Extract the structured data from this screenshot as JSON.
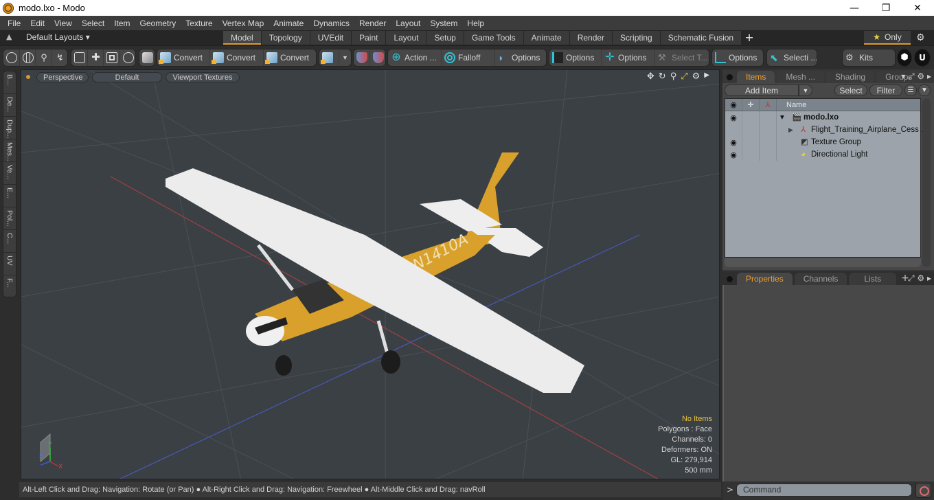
{
  "window": {
    "title": "modo.lxo - Modo",
    "controls": {
      "minimize": "—",
      "maximize": "❐",
      "close": "✕"
    }
  },
  "menu": [
    "File",
    "Edit",
    "View",
    "Select",
    "Item",
    "Geometry",
    "Texture",
    "Vertex Map",
    "Animate",
    "Dynamics",
    "Render",
    "Layout",
    "System",
    "Help"
  ],
  "layout_bar": {
    "default_layouts": "Default Layouts ▾",
    "tabs": [
      "Model",
      "Topology",
      "UVEdit",
      "Paint",
      "Layout",
      "Setup",
      "Game Tools",
      "Animate",
      "Render",
      "Scripting",
      "Schematic Fusion"
    ],
    "active_tab": "Model",
    "add_tab": "+",
    "only_label": "Only",
    "star_icon": "★",
    "gear_icon": "⚙"
  },
  "toolbar": {
    "convert_1": "Convert",
    "convert_2": "Convert",
    "convert_3": "Convert",
    "action": "Action ...",
    "falloff": "Falloff",
    "options_1": "Options",
    "options_2": "Options",
    "options_3": "Options",
    "select_t": "Select T...",
    "options_4": "Options",
    "selecti": "Selecti ...",
    "kits": "Kits"
  },
  "left_rail": [
    "B...",
    "De...",
    "Dup...",
    "Mes...",
    "Ve...",
    "E...",
    "Pol...",
    "C...",
    "UV",
    "F..."
  ],
  "viewport": {
    "view_mode": "Perspective",
    "shading": "Default",
    "textures": "Viewport Textures",
    "info": {
      "selection": "No Items",
      "polygons": "Polygons : Face",
      "channels": "Channels: 0",
      "deformers": "Deformers: ON",
      "gl": "GL: 279,914",
      "scale": "500 mm"
    },
    "model": {
      "tail_number": "N1410A",
      "body_color": "#d9a12c"
    },
    "axis": {
      "x": "X",
      "y": "Y",
      "z": "Z"
    }
  },
  "status_bar": "Alt-Left Click and Drag: Navigation: Rotate (or Pan) ● Alt-Right Click and Drag: Navigation: Freewheel ● Alt-Middle Click and Drag: navRoll",
  "items_panel": {
    "tabs": [
      "Items",
      "Mesh ...",
      "Shading",
      "Groups"
    ],
    "active_tab": "Items",
    "add_item": "Add Item",
    "select": "Select",
    "filter": "Filter",
    "column_name": "Name",
    "rows": [
      {
        "name": "modo.lxo",
        "visible": true
      },
      {
        "name": "Flight_Training_Airplane_Cess ...",
        "visible": false
      },
      {
        "name": "Texture Group",
        "visible": true
      },
      {
        "name": "Directional Light",
        "visible": true
      }
    ]
  },
  "properties_panel": {
    "tabs": [
      "Properties",
      "Channels",
      "Lists"
    ],
    "active_tab": "Properties",
    "add_tab": "+"
  },
  "command": {
    "prompt": ">",
    "placeholder": "Command"
  },
  "colors": {
    "accent": "#e29a2c",
    "active_tab_text": "#f0a030",
    "viewport_bg": "#3b4045"
  }
}
